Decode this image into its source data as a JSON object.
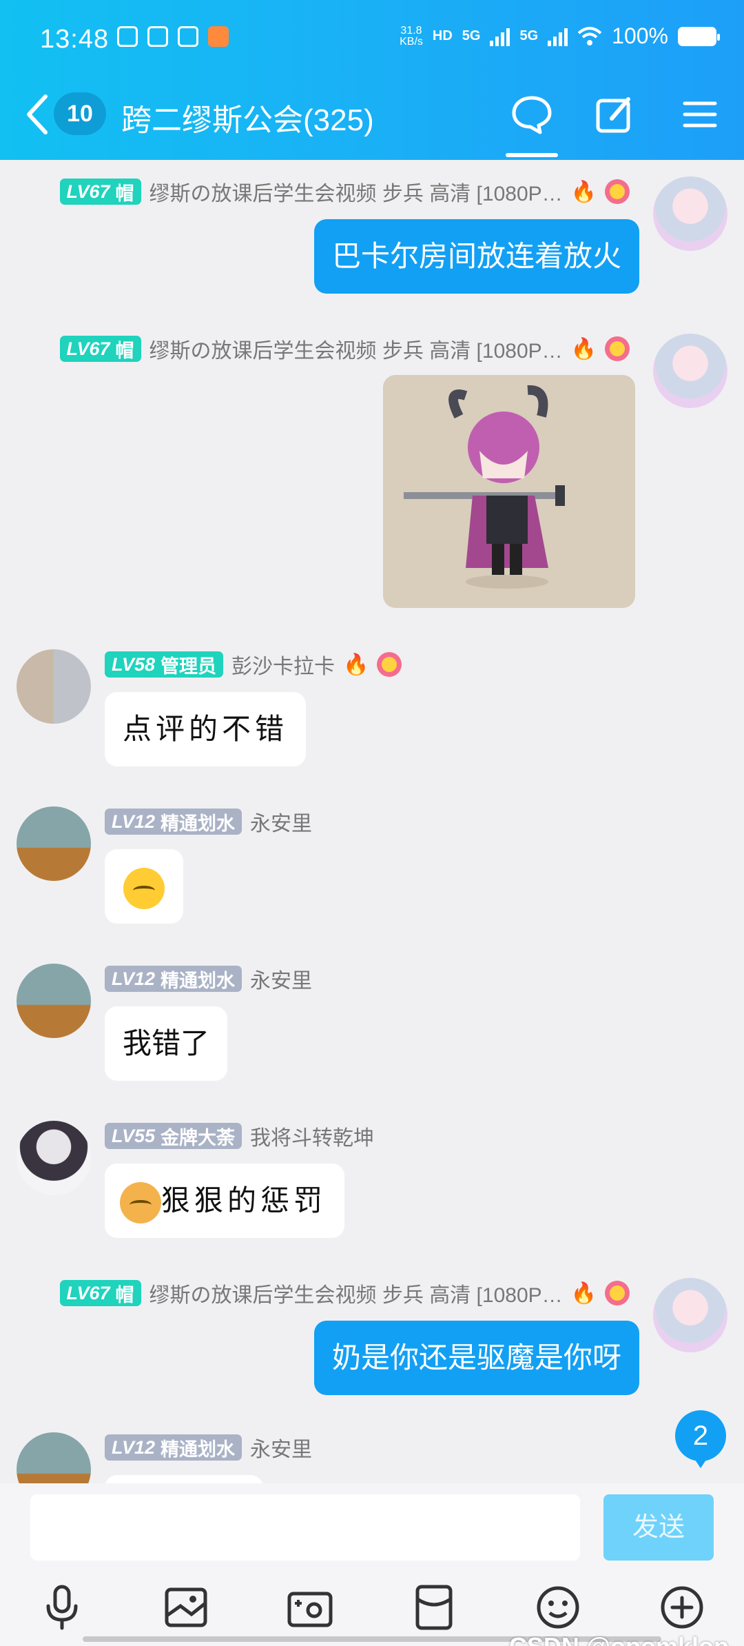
{
  "status": {
    "time": "13:48",
    "kbs_top": "31.8",
    "kbs_bottom": "KB/s",
    "net1": "5G",
    "net2": "5G",
    "battery": "100%"
  },
  "header": {
    "unread_count": "10",
    "title": "跨二缪斯公会(325)"
  },
  "messages": [
    {
      "level": "LV67",
      "tag": "帽",
      "nick": "缪斯の放课后学生会视频 步兵 高清 [1080P…",
      "text": "巴卡尔房间放连着放火"
    },
    {
      "level": "LV67",
      "tag": "帽",
      "nick": "缪斯の放课后学生会视频 步兵 高清 [1080P…"
    },
    {
      "level": "LV58",
      "tag": "管理员",
      "nick": "彭沙卡拉卡",
      "text": "点评的不错"
    },
    {
      "level": "LV12",
      "tag": "精通划水",
      "nick": "永安里"
    },
    {
      "level": "LV12",
      "tag": "精通划水",
      "nick": "永安里",
      "text": "我错了"
    },
    {
      "level": "LV55",
      "tag": "金牌大荼",
      "nick": "我将斗转乾坤",
      "text": "狠狠的惩罚"
    },
    {
      "level": "LV67",
      "tag": "帽",
      "nick": "缪斯の放课后学生会视频 步兵 高清 [1080P…",
      "text": "奶是你还是驱魔是你呀"
    },
    {
      "level": "LV12",
      "tag": "精通划水",
      "nick": "永安里"
    }
  ],
  "unread_badge": "2",
  "input": {
    "send_label": "发送"
  },
  "watermark": "CSDN @opomklop",
  "colors": {
    "accent": "#12a0f4",
    "header_start": "#12c0f2",
    "level_teal": "#1fd3bd",
    "level_gray": "#aab2c6"
  }
}
